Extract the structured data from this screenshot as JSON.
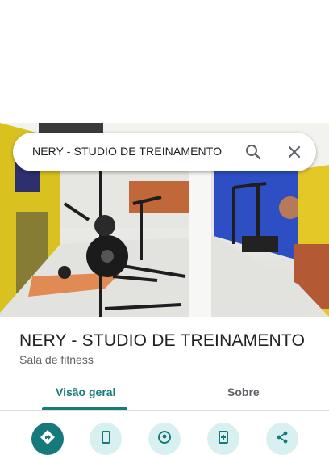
{
  "search": {
    "query": "NERY - STUDIO DE TREINAMENTO",
    "search_icon": "search-icon",
    "close_icon": "close-icon"
  },
  "place": {
    "title": "NERY - STUDIO DE TREINAMENTO",
    "category": "Sala de fitness"
  },
  "tabs": [
    {
      "label": "Visão geral",
      "selected": true
    },
    {
      "label": "Sobre",
      "selected": false
    }
  ],
  "actions": [
    {
      "icon": "directions-icon"
    },
    {
      "icon": "phone-icon"
    },
    {
      "icon": "location-icon"
    },
    {
      "icon": "save-icon"
    },
    {
      "icon": "share-icon"
    }
  ],
  "colors": {
    "accent": "#1a7a7a",
    "action_bg": "#d9f0f1",
    "wall_blue": "#2e4fc4",
    "wall_yellow": "#e3c826"
  }
}
